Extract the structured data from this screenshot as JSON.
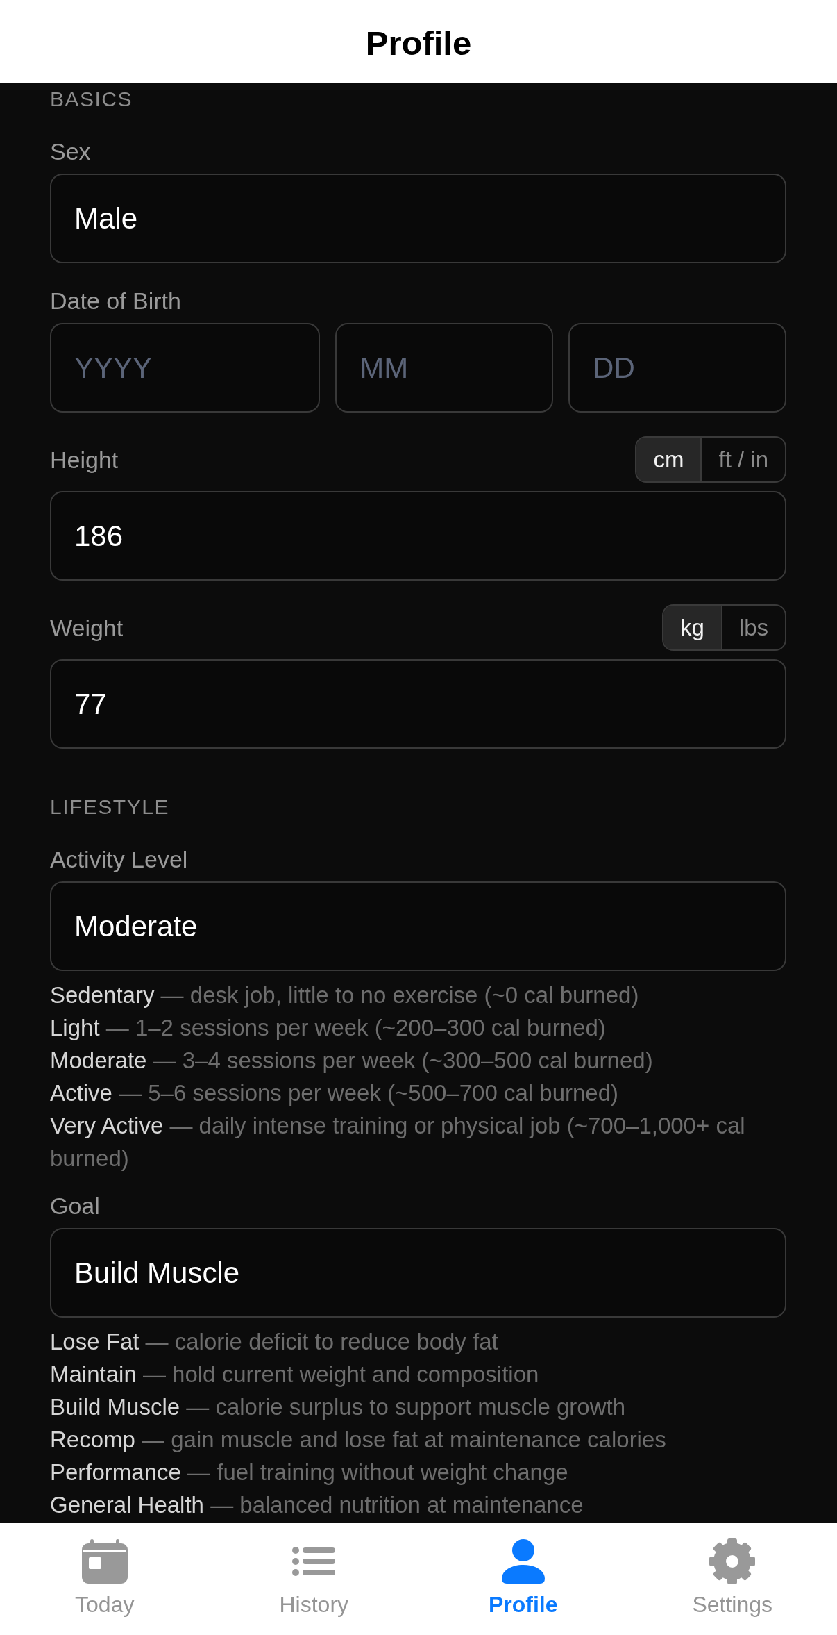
{
  "header": {
    "title": "Profile"
  },
  "sections": [
    {
      "title": "BASICS",
      "fields": [
        {
          "kind": "text",
          "label": "Sex",
          "value": "Male"
        },
        {
          "kind": "date",
          "label": "Date of Birth",
          "parts": [
            {
              "placeholder": "YYYY"
            },
            {
              "placeholder": "MM"
            },
            {
              "placeholder": "DD"
            }
          ]
        },
        {
          "kind": "unit",
          "label": "Height",
          "units": [
            {
              "label": "cm",
              "selected": true
            },
            {
              "label": "ft / in",
              "selected": false
            }
          ],
          "value": "186"
        },
        {
          "kind": "unit",
          "label": "Weight",
          "units": [
            {
              "label": "kg",
              "selected": true
            },
            {
              "label": "lbs",
              "selected": false
            }
          ],
          "value": "77"
        }
      ]
    },
    {
      "title": "LIFESTYLE",
      "fields": [
        {
          "kind": "picker",
          "label": "Activity Level",
          "value": "Moderate",
          "options": [
            {
              "name": "Sedentary",
              "description": "— desk job, little to no exercise (~0 cal burned)"
            },
            {
              "name": "Light",
              "description": "— 1–2 sessions per week (~200–300 cal burned)"
            },
            {
              "name": "Moderate",
              "description": "— 3–4 sessions per week (~300–500 cal burned)"
            },
            {
              "name": "Active",
              "description": "— 5–6 sessions per week (~500–700 cal burned)"
            },
            {
              "name": "Very Active",
              "description": "— daily intense training or physical job (~700–1,000+ cal burned)"
            }
          ]
        },
        {
          "kind": "picker",
          "label": "Goal",
          "value": "Build Muscle",
          "options": [
            {
              "name": "Lose Fat",
              "description": "— calorie deficit to reduce body fat"
            },
            {
              "name": "Maintain",
              "description": "— hold current weight and composition"
            },
            {
              "name": "Build Muscle",
              "description": "— calorie surplus to support muscle growth"
            },
            {
              "name": "Recomp",
              "description": "— gain muscle and lose fat at maintenance calories"
            },
            {
              "name": "Performance",
              "description": "— fuel training without weight change"
            },
            {
              "name": "General Health",
              "description": "— balanced nutrition at maintenance"
            }
          ]
        }
      ]
    }
  ],
  "tab_bar": {
    "tabs": [
      {
        "label": "Today",
        "selected": false
      },
      {
        "label": "History",
        "selected": false
      },
      {
        "label": "Profile",
        "selected": true
      },
      {
        "label": "Settings",
        "selected": false
      }
    ]
  }
}
